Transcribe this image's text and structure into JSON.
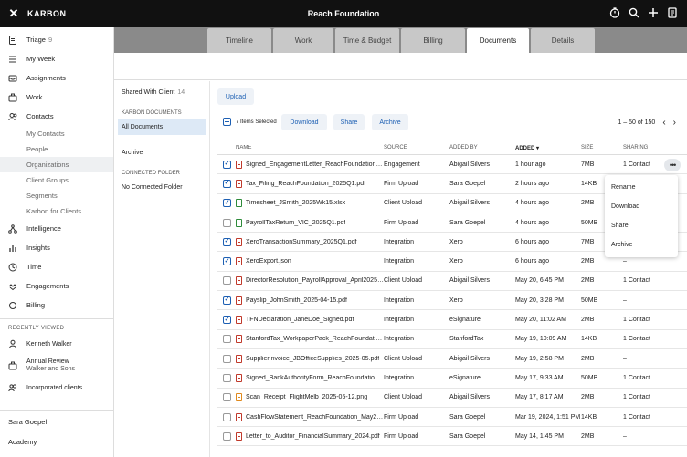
{
  "topbar": {
    "brand": "KARBON",
    "title": "Reach Foundation"
  },
  "sidebar": {
    "items": [
      {
        "label": "Triage",
        "count": "9",
        "icon": "doc-icon"
      },
      {
        "label": "My Week",
        "icon": "list-icon"
      },
      {
        "label": "Assignments",
        "icon": "inbox-icon"
      },
      {
        "label": "Work",
        "icon": "briefcase-icon"
      },
      {
        "label": "Contacts",
        "icon": "contacts-icon"
      }
    ],
    "contact_subitems": [
      "My Contacts",
      "People",
      "Organizations",
      "Client Groups",
      "Segments",
      "Karbon for Clients"
    ],
    "items2": [
      {
        "label": "Intelligence",
        "icon": "intelligence-icon"
      },
      {
        "label": "Insights",
        "icon": "chart-icon"
      },
      {
        "label": "Time",
        "icon": "clock-icon"
      },
      {
        "label": "Engagements",
        "icon": "engagements-icon"
      },
      {
        "label": "Billing",
        "icon": "billing-icon"
      }
    ],
    "recently_viewed_label": "RECENTLY VIEWED",
    "recent": [
      {
        "line1": "Kenneth Walker",
        "line2": ""
      },
      {
        "line1": "Annual Review",
        "line2": "Walker and Sons"
      },
      {
        "line1": "Incorporated clients",
        "line2": ""
      }
    ],
    "user": "Sara Goepel",
    "academy": "Academy"
  },
  "tabs": [
    "Timeline",
    "Work",
    "Time & Budget",
    "Billing",
    "Documents",
    "Details"
  ],
  "active_tab": "Documents",
  "leftpanel": {
    "shared": {
      "label": "Shared With Client",
      "count": "14"
    },
    "karbon_docs_label": "KARBON DOCUMENTS",
    "all_docs": "All Documents",
    "archive": "Archive",
    "connected_label": "CONNECTED FOLDER",
    "no_connected": "No Connected Folder"
  },
  "main": {
    "upload": "Upload",
    "selected": "7 Items Selected",
    "download": "Download",
    "share": "Share",
    "archive": "Archive",
    "pager": "1 – 50 of 150"
  },
  "table": {
    "headers": {
      "name": "NAME",
      "source": "SOURCE",
      "added_by": "ADDED BY",
      "added": "ADDED",
      "size": "SIZE",
      "sharing": "SHARING"
    },
    "rows": [
      {
        "checked": true,
        "type": "pdf",
        "name": "Signed_EngagementLetter_ReachFoundation.pdf",
        "source": "Engagement",
        "added_by": "Abigail Silvers",
        "added": "1 hour ago",
        "size": "7MB",
        "sharing": "1 Contact"
      },
      {
        "checked": true,
        "type": "pdf",
        "name": "Tax_Filing_ReachFoundation_2025Q1.pdf",
        "source": "Firm Upload",
        "added_by": "Sara Goepel",
        "added": "2 hours ago",
        "size": "14KB",
        "sharing": "1 Contact"
      },
      {
        "checked": true,
        "type": "sheet",
        "name": "Timesheet_JSmith_2025Wk15.xlsx",
        "source": "Client Upload",
        "added_by": "Abigail Silvers",
        "added": "4 hours ago",
        "size": "2MB",
        "sharing": "1 Contact"
      },
      {
        "checked": false,
        "type": "sheet",
        "name": "PayrollTaxReturn_VIC_2025Q1.pdf",
        "source": "Firm Upload",
        "added_by": "Sara Goepel",
        "added": "4 hours ago",
        "size": "50MB",
        "sharing": "1 Contact"
      },
      {
        "checked": true,
        "type": "pdf",
        "name": "XeroTransactionSummary_2025Q1.pdf",
        "source": "Integration",
        "added_by": "Xero",
        "added": "6 hours ago",
        "size": "7MB",
        "sharing": "1 Contact"
      },
      {
        "checked": true,
        "type": "pdf",
        "name": "XeroExport.json",
        "source": "Integration",
        "added_by": "Xero",
        "added": "6 hours ago",
        "size": "2MB",
        "sharing": "–"
      },
      {
        "checked": false,
        "type": "pdf",
        "name": "DirectorResolution_PayrollApproval_April2025.pdf",
        "source": "Client Upload",
        "added_by": "Abigail Silvers",
        "added": "May 20, 6:45 PM",
        "size": "2MB",
        "sharing": "1 Contact"
      },
      {
        "checked": true,
        "type": "pdf",
        "name": "Payslip_JohnSmith_2025-04-15.pdf",
        "source": "Integration",
        "added_by": "Xero",
        "added": "May 20, 3:28 PM",
        "size": "50MB",
        "sharing": "–"
      },
      {
        "checked": true,
        "type": "pdf",
        "name": "TFNDeclaration_JaneDoe_Signed.pdf",
        "source": "Integration",
        "added_by": "eSignature",
        "added": "May 20, 11:02 AM",
        "size": "2MB",
        "sharing": "1 Contact"
      },
      {
        "checked": false,
        "type": "pdf",
        "name": "StanfordTax_WorkpaperPack_ReachFoundation.pdf",
        "source": "Integration",
        "added_by": "StanfordTax",
        "added": "May 19, 10:09 AM",
        "size": "14KB",
        "sharing": "1 Contact"
      },
      {
        "checked": false,
        "type": "pdf",
        "name": "SupplierInvoice_JBOfficeSupplies_2025-05.pdf",
        "source": "Client Upload",
        "added_by": "Abigail Silvers",
        "added": "May 19, 2:58 PM",
        "size": "2MB",
        "sharing": "–"
      },
      {
        "checked": false,
        "type": "pdf",
        "name": "Signed_BankAuthorityForm_ReachFoundation.pdf",
        "source": "Integration",
        "added_by": "eSignature",
        "added": "May 17, 9:33 AM",
        "size": "50MB",
        "sharing": "1 Contact"
      },
      {
        "checked": false,
        "type": "img",
        "name": "Scan_Receipt_FlightMelb_2025-05-12.png",
        "source": "Client Upload",
        "added_by": "Abigail Silvers",
        "added": "May 17, 8:17 AM",
        "size": "2MB",
        "sharing": "1 Contact"
      },
      {
        "checked": false,
        "type": "pdf",
        "name": "CashFlowStatement_ReachFoundation_May2025.pdf",
        "source": "Firm Upload",
        "added_by": "Sara Goepel",
        "added": "Mar 19, 2024, 1:51 PM",
        "size": "14KB",
        "sharing": "1 Contact"
      },
      {
        "checked": false,
        "type": "pdf",
        "name": "Letter_to_Auditor_FinancialSummary_2024.pdf",
        "source": "Firm Upload",
        "added_by": "Sara Goepel",
        "added": "May 14, 1:45 PM",
        "size": "2MB",
        "sharing": "–"
      }
    ]
  },
  "context_menu": [
    "Rename",
    "Download",
    "Share",
    "Archive"
  ]
}
